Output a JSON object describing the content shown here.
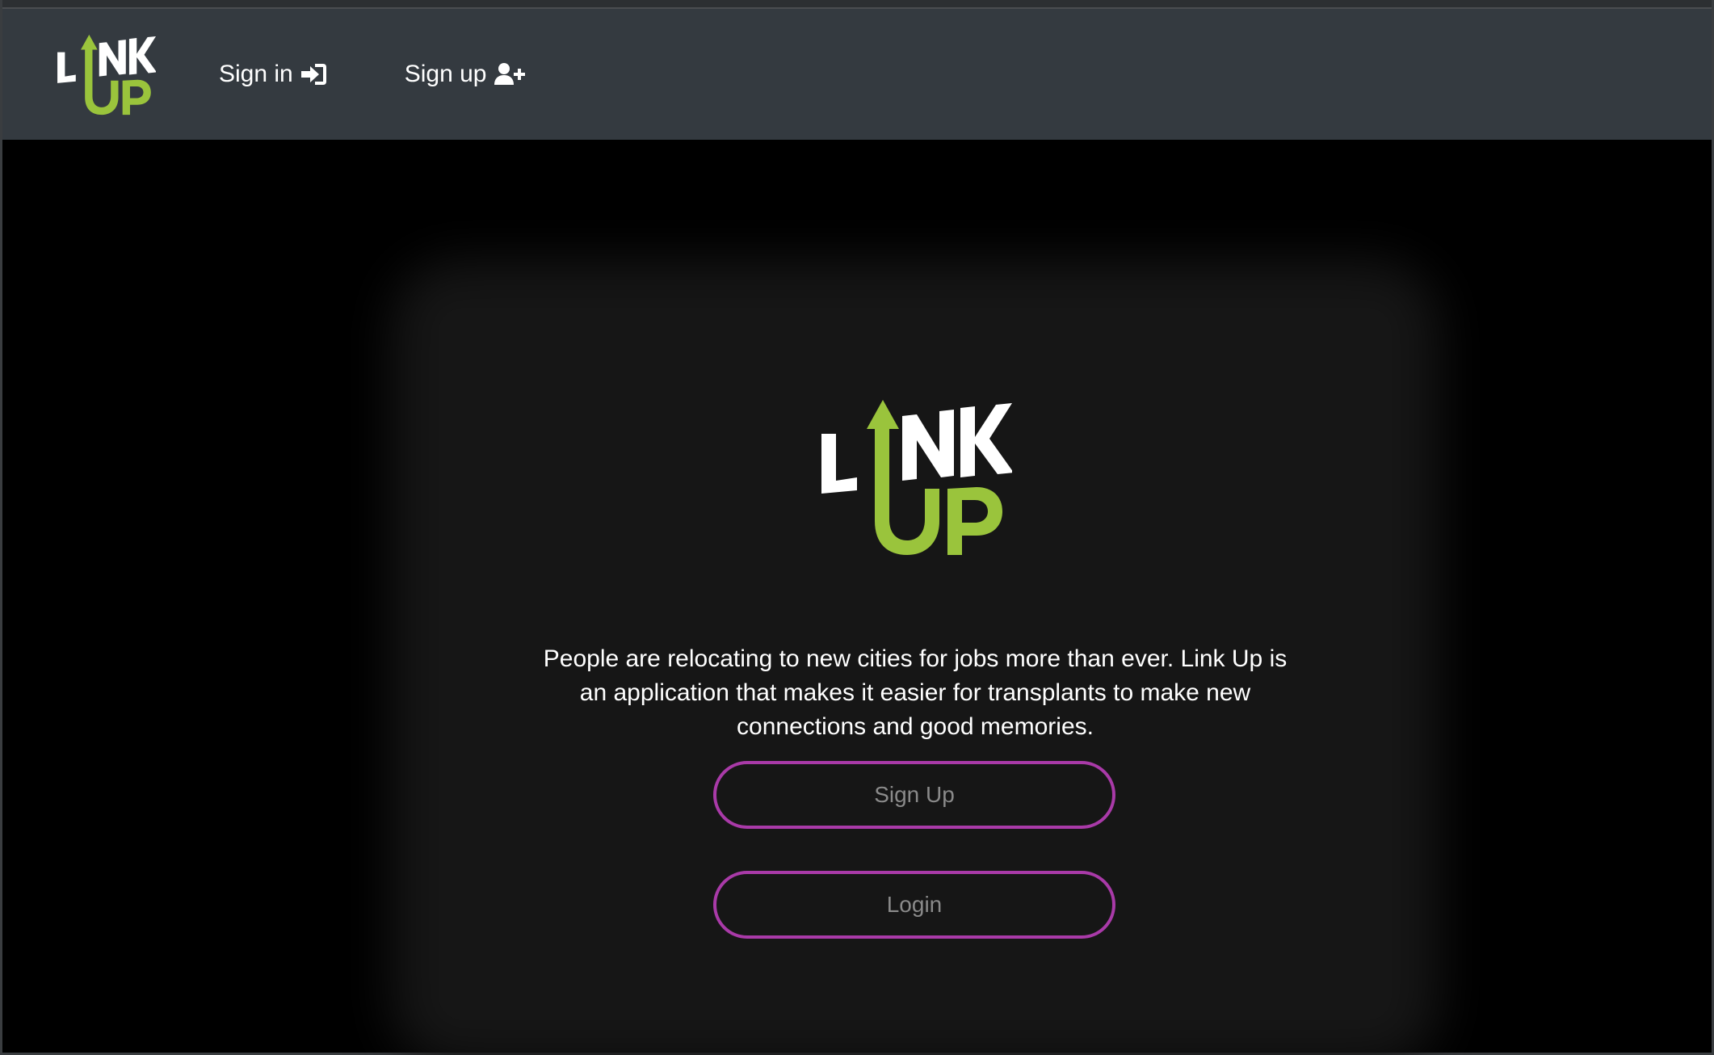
{
  "brand": {
    "logo_text_top": "LINK",
    "logo_text_bottom": "UP",
    "logo_colors": {
      "white": "#ffffff",
      "green": "#9ac43c"
    }
  },
  "navbar": {
    "signin_label": "Sign in",
    "signin_icon": "sign-in-icon",
    "signup_label": "Sign up",
    "signup_icon": "user-plus-icon"
  },
  "main": {
    "description": "People are relocating to new cities for jobs more than ever. Link Up is an application that makes it easier for transplants to make new connections and good memories.",
    "signup_button_label": "Sign Up",
    "login_button_label": "Login"
  },
  "colors": {
    "navbar_bg": "#343a40",
    "card_bg": "#161616",
    "button_border": "#a93aa8",
    "button_text": "#8a8a8a"
  }
}
